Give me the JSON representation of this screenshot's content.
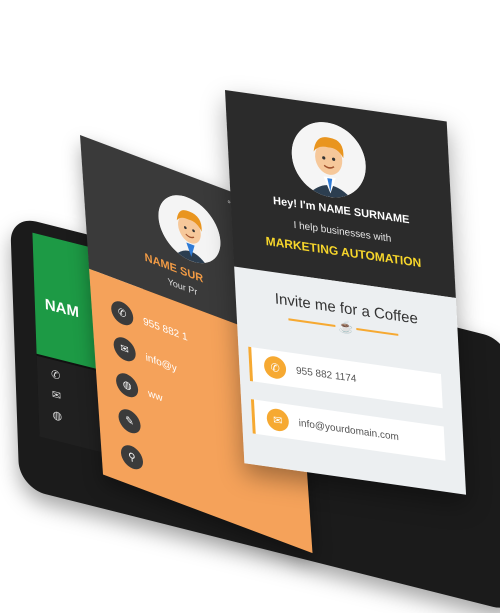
{
  "front_card": {
    "greeting": "Hey! I'm NAME SURNAME",
    "help_text": "I help businesses with",
    "specialty": "MARKETING AUTOMATION",
    "coffee_title": "Invite me for a Coffee",
    "phone": "955 882 1174",
    "email": "info@yourdomain.com",
    "accent_color": "#f6a932",
    "specialty_color": "#f7d62b"
  },
  "middle_card": {
    "name": "NAME SUR",
    "subtitle": "Your Pr",
    "status_icons": "◦ ▾ ◢ ▮",
    "rows": [
      {
        "icon": "phone-icon",
        "text": "955 882 1"
      },
      {
        "icon": "email-icon",
        "text": "info@y"
      },
      {
        "icon": "globe-icon",
        "text": "ww"
      },
      {
        "icon": "chat-icon",
        "text": ""
      },
      {
        "icon": "pin-icon",
        "text": ""
      }
    ],
    "accent_color": "#f5a25a"
  },
  "back_card": {
    "name": "NAM",
    "accent_color": "#1d9a45"
  }
}
